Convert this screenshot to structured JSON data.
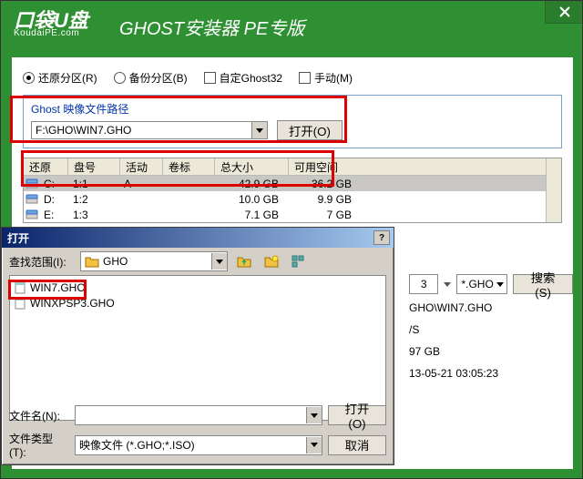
{
  "app": {
    "logo": "口袋U盘",
    "logo_sub": "KoudaiPE.com",
    "title": "GHOST安装器   PE专版"
  },
  "options": {
    "restore": "还原分区(R)",
    "backup": "备份分区(B)",
    "ghost32": "自定Ghost32",
    "manual": "手动(M)"
  },
  "path_group": {
    "title": "Ghost 映像文件路径",
    "value": "F:\\GHO\\WIN7.GHO",
    "open_label": "打开(O)"
  },
  "drives": {
    "headers": {
      "restore": "还原",
      "disk": "盘号",
      "active": "活动",
      "label": "卷标",
      "size": "总大小",
      "free": "可用空间"
    },
    "rows": [
      {
        "drive": "C:",
        "disk": "1:1",
        "active": "A",
        "label": "",
        "size": "42.9 GB",
        "free": "36.2 GB",
        "selected": true
      },
      {
        "drive": "D:",
        "disk": "1:2",
        "active": "",
        "label": "",
        "size": "10.0 GB",
        "free": "9.9 GB",
        "selected": false
      },
      {
        "drive": "E:",
        "disk": "1:3",
        "active": "",
        "label": "",
        "size": "7.1 GB",
        "free": "7 GB",
        "selected": false
      }
    ]
  },
  "filter_bar": {
    "spin_value": "3",
    "ext_filter": "*.GHO",
    "search_label": "搜索(S)"
  },
  "info": {
    "path_tail": "GHO\\WIN7.GHO",
    "fs_tail": "/S",
    "free_tail": "97 GB",
    "mtime_tail": "13-05-21 03:05:23"
  },
  "dialog": {
    "title": "打开",
    "help": "?",
    "lookin_label": "查找范围(I):",
    "folder": "GHO",
    "files": [
      "WIN7.GHO",
      "WINXPSP3.GHO"
    ],
    "filename_label": "文件名(N):",
    "filename_value": "",
    "filetype_label": "文件类型(T):",
    "filetype_value": "映像文件 (*.GHO;*.ISO)",
    "open_btn": "打开(O)",
    "cancel_btn": "取消"
  }
}
